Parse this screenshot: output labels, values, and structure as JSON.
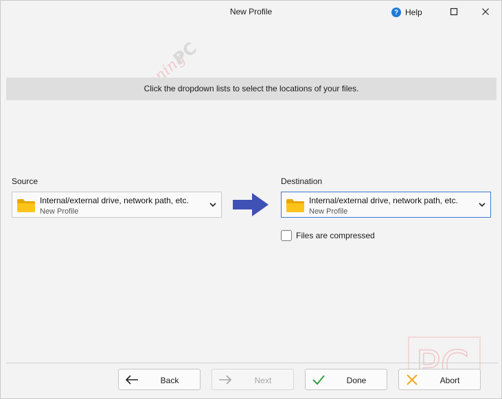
{
  "window": {
    "title": "New Profile",
    "help_label": "Help"
  },
  "watermark": {
    "text_script": "Winning",
    "text_bold": "PC",
    "corner_logo": "PC"
  },
  "banner": {
    "text": "Click the dropdown lists to select the locations of your files."
  },
  "source": {
    "label": "Source",
    "primary": "Internal/external drive, network path, etc.",
    "secondary": "New Profile",
    "icon": "folder-icon"
  },
  "destination": {
    "label": "Destination",
    "primary": "Internal/external drive, network path, etc.",
    "secondary": "New Profile",
    "icon": "folder-icon"
  },
  "options": {
    "compressed_label": "Files are compressed",
    "compressed_checked": false
  },
  "buttons": {
    "back": "Back",
    "next": "Next",
    "done": "Done",
    "abort": "Abort"
  },
  "colors": {
    "arrow": "#3f51b5",
    "folder": "#f5b800",
    "help": "#1e78d7",
    "done_check": "#2e9e3e",
    "abort_x": "#f0a91a",
    "focus_border": "#3d7ad3"
  }
}
